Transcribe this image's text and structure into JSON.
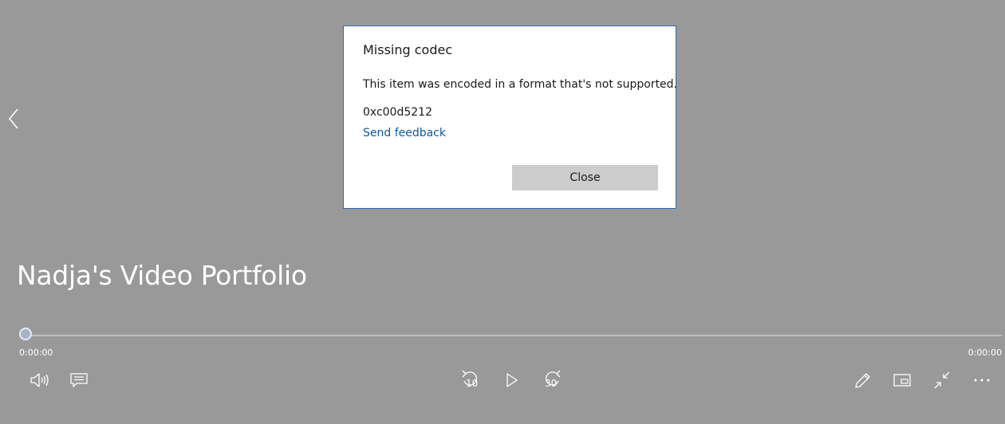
{
  "dialog": {
    "title": "Missing codec",
    "message": "This item was encoded in a format that's not supported.",
    "error_code": "0xc00d5212",
    "feedback_link": "Send feedback",
    "close_label": "Close"
  },
  "video": {
    "title": "Nadja's Video Portfolio"
  },
  "player": {
    "current_time": "0:00:00",
    "total_time": "0:00:00",
    "skip_back_seconds": "10",
    "skip_forward_seconds": "30",
    "progress_fraction": 0
  },
  "icons": {
    "back": "chevron-left-icon",
    "volume": "volume-icon",
    "captions": "captions-icon",
    "skip_back": "skip-back-icon",
    "play": "play-icon",
    "skip_forward": "skip-forward-icon",
    "edit": "pencil-icon",
    "mini_view": "mini-view-icon",
    "exit_fullscreen": "exit-fullscreen-icon",
    "more": "more-icon"
  },
  "colors": {
    "background": "#999999",
    "dialog_border": "#2b6cb0",
    "link": "#0b5a9c",
    "button": "#cccccc"
  }
}
